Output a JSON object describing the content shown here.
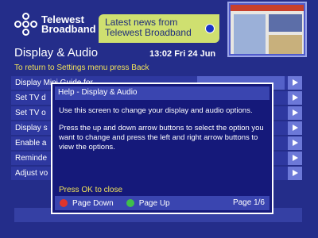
{
  "header": {
    "logo_line1": "Telewest",
    "logo_line2": "Broadband",
    "news_line1": "Latest news from",
    "news_line2": "Telewest Broadband"
  },
  "page": {
    "title": "Display & Audio",
    "datetime": "13:02 Fri 24 Jun",
    "instruction": "To return to Settings menu press Back"
  },
  "menu": {
    "items": [
      {
        "label": "Display Mini Guide for"
      },
      {
        "label": "Set TV d"
      },
      {
        "label": "Set TV o"
      },
      {
        "label": "Display s"
      },
      {
        "label": "Enable a"
      },
      {
        "label": "Reminde"
      },
      {
        "label": "Adjust vo"
      }
    ]
  },
  "dialog": {
    "title": "Help - Display & Audio",
    "para1": "Use this screen to change your display and audio options.",
    "para2": "Press the up and down arrow buttons to select the option you want to change and press the left and right arrow buttons to view the options.",
    "ok_text": "Press OK to close",
    "page_down": "Page Down",
    "page_up": "Page Up",
    "page_indicator": "Page 1/6"
  },
  "colors": {
    "background": "#242d8a",
    "accent_yellow": "#f2e35a",
    "news_bg": "#cfe070",
    "red_button": "#e0352c",
    "green_button": "#3fbf4a"
  }
}
